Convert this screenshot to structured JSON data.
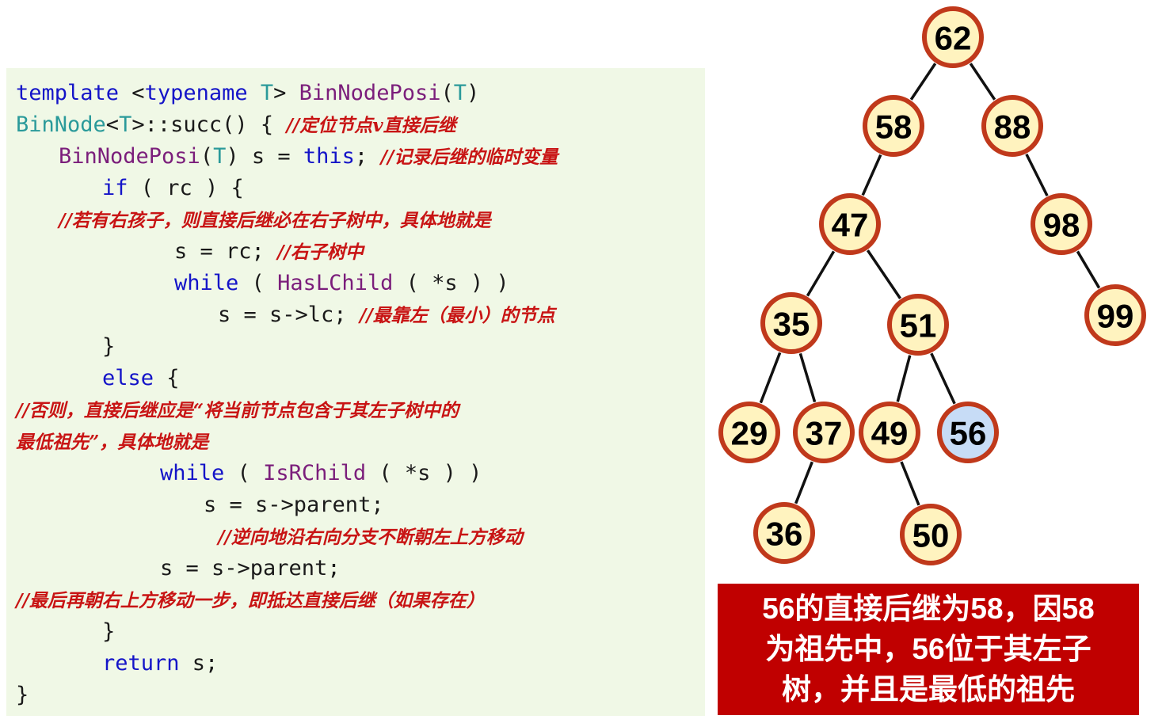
{
  "code": {
    "l1": {
      "a": "template",
      "b": " <",
      "c": "typename",
      "d": " ",
      "e": "T",
      "f": "> ",
      "g": "BinNodePosi",
      "h": "(",
      "i": "T",
      "j": ")"
    },
    "l2": {
      "a": "BinNode",
      "b": "<",
      "c": "T",
      "d": ">::succ() { ",
      "e": "//定位节点v直接后继"
    },
    "l3": {
      "a": "BinNodePosi",
      "b": "(",
      "c": "T",
      "d": ") s = ",
      "e": "this",
      "f": "; ",
      "g": "//记录后继的临时变量"
    },
    "l4": {
      "a": "if",
      "b": " ( rc ) {"
    },
    "l5": {
      "a": "//若有右孩子，则直接后继必在右子树中，具体地就是"
    },
    "l6": {
      "a": "s = rc; ",
      "b": "//右子树中"
    },
    "l7": {
      "a": "while",
      "b": " ( ",
      "c": "HasLChild",
      "d": " ( *s ) )"
    },
    "l8": {
      "a": "s = s->lc; ",
      "b": "//最靠左（最小）的节点"
    },
    "l9": {
      "a": "}"
    },
    "l10": {
      "a": "else",
      "b": " {"
    },
    "l11": {
      "a": "//否则，直接后继应是“将当前节点包含于其左子树中的"
    },
    "l12": {
      "a": "最低祖先”，具体地就是"
    },
    "l13": {
      "a": "while",
      "b": " ( ",
      "c": "IsRChild",
      "d": " ( *s ) )"
    },
    "l14": {
      "a": "s = s->parent;"
    },
    "l15": {
      "a": "//逆向地沿右向分支不断朝左上方移动"
    },
    "l16": {
      "a": "s = s->parent;"
    },
    "l17": {
      "a": "//最后再朝右上方移动一步，即抵达直接后继（如果存在）"
    },
    "l18": {
      "a": "}"
    },
    "l19": {
      "a": "return",
      "b": " s;"
    },
    "l20": {
      "a": "}"
    }
  },
  "tree": {
    "nodes": [
      {
        "id": "62",
        "label": "62",
        "highlight": false
      },
      {
        "id": "58",
        "label": "58",
        "highlight": false
      },
      {
        "id": "88",
        "label": "88",
        "highlight": false
      },
      {
        "id": "47",
        "label": "47",
        "highlight": false
      },
      {
        "id": "98",
        "label": "98",
        "highlight": false
      },
      {
        "id": "35",
        "label": "35",
        "highlight": false
      },
      {
        "id": "51",
        "label": "51",
        "highlight": false
      },
      {
        "id": "99",
        "label": "99",
        "highlight": false
      },
      {
        "id": "29",
        "label": "29",
        "highlight": false
      },
      {
        "id": "37",
        "label": "37",
        "highlight": false
      },
      {
        "id": "49",
        "label": "49",
        "highlight": false
      },
      {
        "id": "56",
        "label": "56",
        "highlight": true
      },
      {
        "id": "36",
        "label": "36",
        "highlight": false
      },
      {
        "id": "50",
        "label": "50",
        "highlight": false
      }
    ],
    "edges": [
      [
        "62",
        "58"
      ],
      [
        "62",
        "88"
      ],
      [
        "58",
        "47"
      ],
      [
        "88",
        "98"
      ],
      [
        "47",
        "35"
      ],
      [
        "47",
        "51"
      ],
      [
        "98",
        "99"
      ],
      [
        "35",
        "29"
      ],
      [
        "35",
        "37"
      ],
      [
        "51",
        "49"
      ],
      [
        "51",
        "56"
      ],
      [
        "37",
        "36"
      ],
      [
        "49",
        "50"
      ]
    ],
    "colors": {
      "node_fill": "#fff3bf",
      "node_stroke": "#c0391b",
      "highlight_fill": "#c7dcf6",
      "edge": "#111111"
    }
  },
  "callout": {
    "line1": "56的直接后继为58，因58",
    "line2": "为祖先中，56位于其左子",
    "line3": "树，并且是最低的祖先",
    "background": "#c00000"
  }
}
